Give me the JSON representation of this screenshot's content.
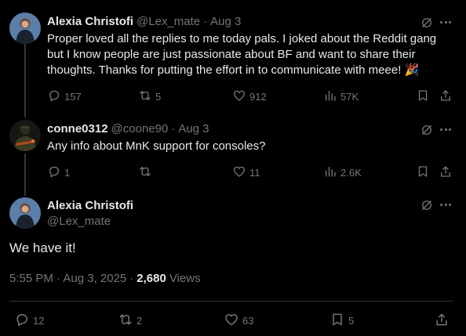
{
  "posts": [
    {
      "name": "Alexia Christofi",
      "handle": "@Lex_mate",
      "sep": "·",
      "date": "Aug 3",
      "text": "Proper loved all the replies to me today pals. I joked about the Reddit gang but I know people are just passionate about BF and want to share their thoughts. Thanks for putting the effort in to communicate with meee! 🎉",
      "replies": "157",
      "reposts": "5",
      "likes": "912",
      "views": "57K"
    },
    {
      "name": "conne0312",
      "handle": "@coone90",
      "sep": "·",
      "date": "Aug 3",
      "text": "Any info about MnK support for consoles?",
      "replies": "1",
      "reposts": "",
      "likes": "11",
      "views": "2.6K"
    }
  ],
  "main_post": {
    "name": "Alexia Christofi",
    "handle": "@Lex_mate",
    "text": "We have it!",
    "time": "5:55 PM · Aug 3, 2025",
    "sep": "·",
    "views_count": "2,680",
    "views_label": "Views",
    "replies": "12",
    "reposts": "2",
    "likes": "63",
    "bookmarks": "5"
  },
  "icons": [
    "grok-icon",
    "more-icon",
    "reply-icon",
    "repost-icon",
    "like-icon",
    "views-icon",
    "bookmark-icon",
    "share-icon"
  ],
  "colors": {
    "background": "#000000",
    "text": "#e7e9ea",
    "muted": "#71767b",
    "divider": "#2f3336"
  }
}
